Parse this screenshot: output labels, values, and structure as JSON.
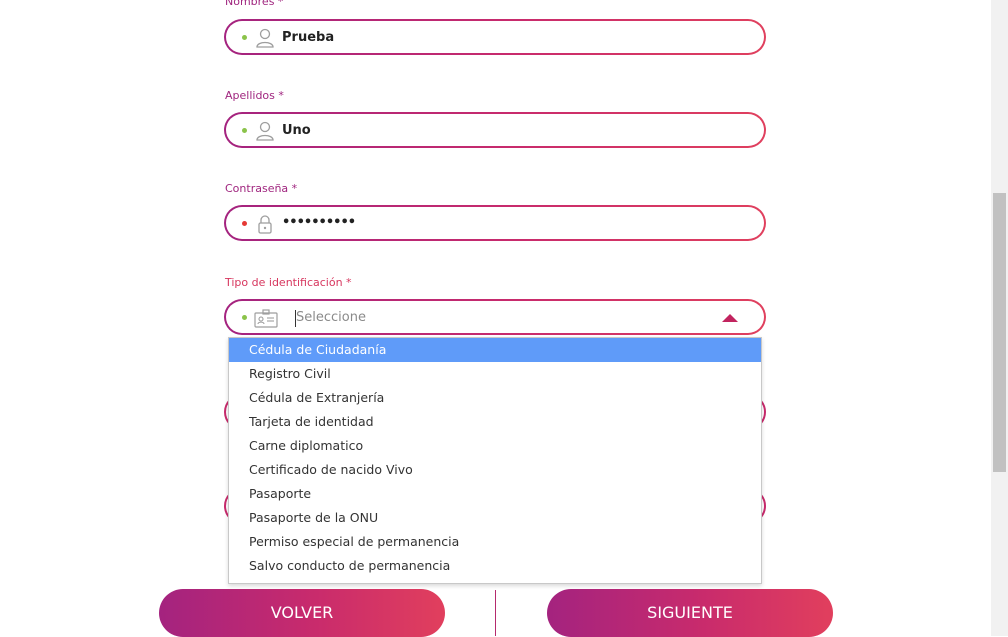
{
  "form": {
    "nombres": {
      "label": "Nombres *",
      "value": "Prueba",
      "icon": "user-icon",
      "status_color": "#8bc34a"
    },
    "apellidos": {
      "label": "Apellidos *",
      "value": "Uno",
      "icon": "user-icon",
      "status_color": "#8bc34a"
    },
    "contrasena": {
      "label": "Contraseña *",
      "value": "••••••••••",
      "icon": "lock-icon",
      "status_color": "#e53935"
    },
    "tipo_identificacion": {
      "label": "Tipo de identificación *",
      "placeholder": "Seleccione",
      "icon": "id-card-icon",
      "status_color": "#8bc34a",
      "options": [
        "Cédula de Ciudadanía",
        "Registro Civil",
        "Cédula de Extranjería",
        "Tarjeta de identidad",
        "Carne diplomatico",
        "Certificado de nacido Vivo",
        "Pasaporte",
        "Pasaporte de la ONU",
        "Permiso especial de permanencia",
        "Salvo conducto de permanencia"
      ],
      "highlighted_index": 0
    }
  },
  "buttons": {
    "back_label": "VOLVER",
    "next_label": "SIGUIENTE"
  },
  "colors": {
    "accent_start": "#a4237f",
    "accent_end": "#e0405e",
    "highlight": "#5f9bf9"
  }
}
